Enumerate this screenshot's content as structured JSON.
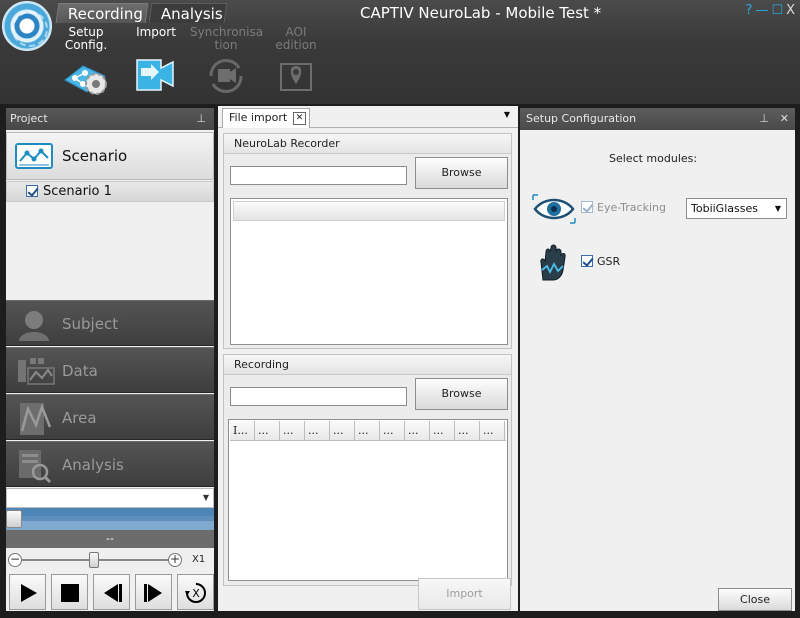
{
  "app": {
    "title": "CAPTIV NeuroLab - Mobile Test *",
    "window_controls": [
      "?",
      "—",
      "☐",
      "X"
    ]
  },
  "ribbon": {
    "tabs": [
      {
        "label": "Recording",
        "active": true
      },
      {
        "label": "Analysis",
        "active": false
      }
    ],
    "buttons": [
      {
        "label": "Setup\nConfig.",
        "icon": "gear-network-icon",
        "enabled": true
      },
      {
        "label": "Import",
        "icon": "camera-import-icon",
        "enabled": true
      },
      {
        "label": "Synchronisa\ntion",
        "icon": "camera-sync-icon",
        "enabled": false
      },
      {
        "label": "AOI edition",
        "icon": "aoi-pin-icon",
        "enabled": false
      }
    ]
  },
  "project": {
    "header": "Project",
    "scenario_header": "Scenario",
    "scenario_items": [
      {
        "label": "Scenario 1",
        "checked": true
      }
    ],
    "nav": [
      {
        "label": "Subject",
        "icon": "subject-icon"
      },
      {
        "label": "Data",
        "icon": "data-icon"
      },
      {
        "label": "Area",
        "icon": "area-icon"
      },
      {
        "label": "Analysis",
        "icon": "analysis-icon"
      }
    ],
    "time_readout": "--",
    "zoom_label": "X1"
  },
  "file_import": {
    "tab_label": "File import",
    "recorder": {
      "title": "NeuroLab Recorder",
      "path_value": "",
      "browse_label": "Browse"
    },
    "recording": {
      "title": "Recording",
      "path_value": "",
      "browse_label": "Browse",
      "columns": [
        "I...",
        "...",
        "...",
        "...",
        "...",
        "...",
        "...",
        "...",
        "...",
        "...",
        "..."
      ]
    },
    "import_label": "Import"
  },
  "setup": {
    "header": "Setup Configuration",
    "select_label": "Select modules:",
    "modules": [
      {
        "label": "Eye-Tracking",
        "checked": true,
        "enabled": false,
        "icon": "eye-tracking-icon",
        "device": "TobiiGlasses"
      },
      {
        "label": "GSR",
        "checked": true,
        "enabled": true,
        "icon": "gsr-hand-icon"
      }
    ],
    "close_label": "Close"
  },
  "colors": {
    "accent": "#29a8e0",
    "ribbon_bg": "#3a3a3a",
    "panel_header": "#4a4a4a",
    "timeline": "#4e86b7"
  }
}
